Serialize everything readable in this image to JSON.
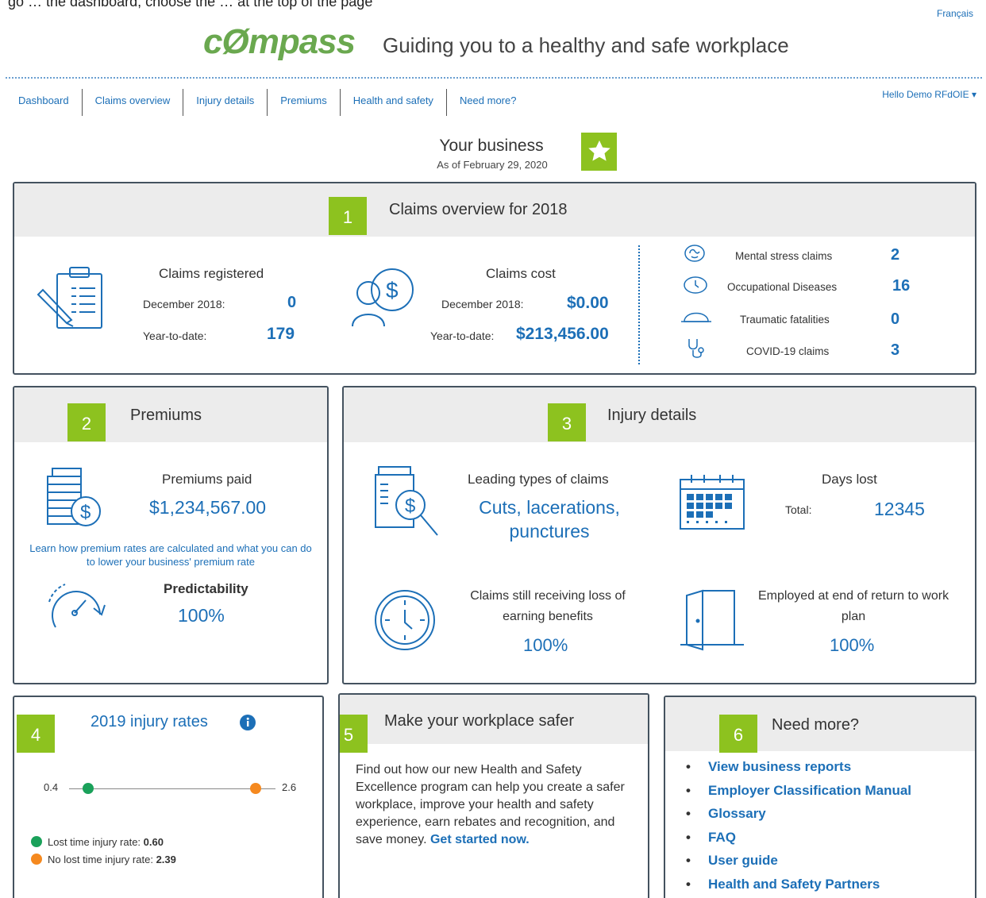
{
  "top_cut_text": "go … the dashboard, choose the … at the top of the page",
  "language_link": "Français",
  "logo": {
    "text": "cØmpass",
    "tagline": "Guiding you to a healthy and safe workplace"
  },
  "nav": {
    "items": [
      "Dashboard",
      "Claims overview",
      "Injury details",
      "Premiums",
      "Health and safety",
      "Need more?"
    ],
    "greeting": "Hello Demo RFdOIE ▾"
  },
  "business": {
    "title": "Your business",
    "date": "As of February 29, 2020"
  },
  "claims": {
    "number": "1",
    "title": "Claims overview for 2018",
    "registered": {
      "label": "Claims registered",
      "dec_label": "December 2018:",
      "dec_value": "0",
      "ytd_label": "Year-to-date:",
      "ytd_value": "179"
    },
    "cost": {
      "label": "Claims cost",
      "dec_label": "December 2018:",
      "dec_value": "$0.00",
      "ytd_label": "Year-to-date:",
      "ytd_value": "$213,456.00"
    },
    "stats": [
      {
        "label": "Mental stress claims",
        "value": "2",
        "icon": "brain-icon"
      },
      {
        "label": "Occupational Diseases",
        "value": "16",
        "icon": "clock-icon"
      },
      {
        "label": "Traumatic fatalities",
        "value": "0",
        "icon": "hard-hat-icon"
      },
      {
        "label": "COVID-19 claims",
        "value": "3",
        "icon": "stethoscope-icon"
      }
    ]
  },
  "premiums": {
    "number": "2",
    "title": "Premiums",
    "paid_label": "Premiums paid",
    "paid_value": "$1,234,567.00",
    "learn_link": "Learn how premium rates are calculated and what you can do to lower your business' premium rate",
    "predict_label": "Predictability",
    "predict_value": "100%"
  },
  "injury": {
    "number": "3",
    "title": "Injury details",
    "leading_label": "Leading types of claims",
    "leading_value": "Cuts, lacerations, punctures",
    "days_label": "Days lost",
    "days_total_label": "Total:",
    "days_total_value": "12345",
    "loe_label": "Claims still receiving loss of earning benefits",
    "loe_value": "100%",
    "employed_label": "Employed at end of return to work plan",
    "employed_value": "100%"
  },
  "rates": {
    "number": "4",
    "title": "2019 injury rates",
    "min": "0.4",
    "max": "2.6",
    "lost_label": "Lost time injury rate:",
    "lost_value": "0.60",
    "nolost_label": "No lost time injury rate:",
    "nolost_value": "2.39",
    "colors": {
      "lost": "#1aa15a",
      "nolost": "#f5891f"
    }
  },
  "safer": {
    "number": "5",
    "title": "Make your workplace safer",
    "body": "Find out how our new Health and Safety Excellence program can help you create a safer workplace, improve your health and safety experience, earn rebates and recognition, and save money.",
    "link": "Get started now."
  },
  "more": {
    "number": "6",
    "title": "Need more?",
    "links": [
      "View business reports",
      "Employer Classification Manual",
      "Glossary",
      "FAQ",
      "User guide",
      "Health and Safety Partners"
    ]
  }
}
